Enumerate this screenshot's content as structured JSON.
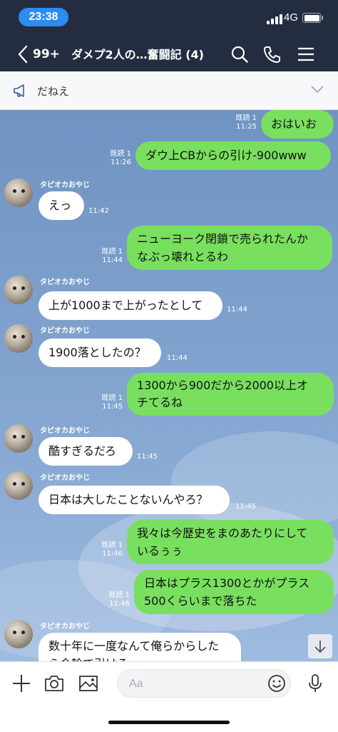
{
  "status_bar": {
    "time": "23:38",
    "network": "4G"
  },
  "header": {
    "back_count": "99+",
    "title": "ダメプ2人の…奮闘記 (4)"
  },
  "announcement": {
    "text": "だねえ"
  },
  "colors": {
    "header_bg": "#232d3f",
    "outgoing_bubble": "#79e05f",
    "incoming_bubble": "#ffffff",
    "chat_bg": "#7e9fc8",
    "time_pill": "#2d8cf0"
  },
  "messages": [
    {
      "dir": "out",
      "read": "既読 1",
      "time": "11:25",
      "lines": [
        "おはいお"
      ]
    },
    {
      "dir": "out",
      "read": "既読 1",
      "time": "11:26",
      "lines": [
        "ダウ上CBからの引け-900www"
      ]
    },
    {
      "dir": "in",
      "sender": "タピオカおやじ",
      "time": "11:42",
      "lines": [
        "えっ"
      ]
    },
    {
      "dir": "out",
      "read": "既読 1",
      "time": "11:44",
      "lines": [
        "ニューヨーク閉鎖で売られたんか",
        "なぶっ壊れとるわ"
      ]
    },
    {
      "dir": "in",
      "sender": "タピオカおやじ",
      "time": "11:44",
      "lines": [
        "上が1000まで上がったとして"
      ]
    },
    {
      "dir": "in",
      "sender": "タピオカおやじ",
      "time": "11:44",
      "lines": [
        "1900落としたの？"
      ]
    },
    {
      "dir": "out",
      "read": "既読 1",
      "time": "11:45",
      "lines": [
        "1300から900だから2000以上オ",
        "チてるね"
      ]
    },
    {
      "dir": "in",
      "sender": "タピオカおやじ",
      "time": "11:45",
      "lines": [
        "酷すぎるだろ"
      ]
    },
    {
      "dir": "in",
      "sender": "タピオカおやじ",
      "time": "11:45",
      "lines": [
        "日本は大したことないんやろ？"
      ]
    },
    {
      "dir": "out",
      "read": "既読 1",
      "time": "11:46",
      "lines": [
        "我々は今歴史をまのあたりにして",
        "いるぅぅ"
      ]
    },
    {
      "dir": "out",
      "read": "既読 1",
      "time": "11:46",
      "lines": [
        "日本はプラス1300とかがプラス",
        "500くらいまで落ちた"
      ]
    },
    {
      "dir": "in",
      "sender": "タピオカおやじ",
      "time": "",
      "lines": [
        "数十年に一度なんて俺らからした",
        "ら金輪で引ける"
      ]
    }
  ],
  "input": {
    "placeholder": "Aa"
  },
  "icons": {
    "back": "chevron-left-icon",
    "search": "search-icon",
    "call": "phone-icon",
    "menu": "hamburger-menu-icon",
    "announce": "megaphone-icon",
    "expand": "chevron-down-icon",
    "scroll": "arrow-down-icon",
    "add": "plus-icon",
    "camera": "camera-icon",
    "image": "image-icon",
    "emoji": "emoji-icon",
    "mic": "microphone-icon"
  }
}
